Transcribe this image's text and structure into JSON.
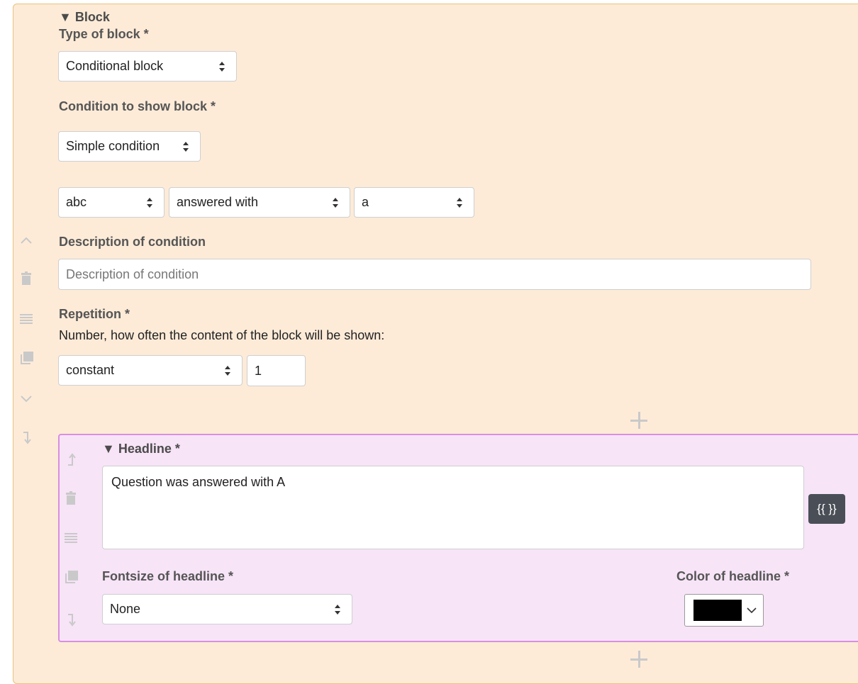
{
  "block": {
    "title": "▼ Block",
    "type_label": "Type of block *",
    "type_value": "Conditional block",
    "condition_label": "Condition to show block *",
    "condition_value": "Simple condition",
    "condition_row": {
      "question": "abc",
      "operator": "answered with",
      "answer": "a"
    },
    "description_label": "Description of condition",
    "description_placeholder": "Description of condition",
    "repetition_label": "Repetition *",
    "repetition_help": "Number, how often the content of the block will be shown:",
    "repetition_mode": "constant",
    "repetition_count": "1"
  },
  "headline": {
    "title": "▼ Headline *",
    "text": "Question was answered with A",
    "variables_button": "{{ }}",
    "fontsize_label": "Fontsize of headline *",
    "fontsize_value": "None",
    "color_label": "Color of headline *",
    "color_value": "#000000"
  },
  "icons": {
    "block_side": [
      "chevron-up-icon",
      "trash-icon",
      "drag-handle-icon",
      "duplicate-icon",
      "chevron-down-icon",
      "move-into-icon"
    ],
    "headline_side": [
      "move-out-icon",
      "trash-icon",
      "drag-handle-icon",
      "duplicate-icon",
      "move-into-icon"
    ],
    "add": "plus-icon"
  },
  "colors": {
    "block_bg": "#fdebd8",
    "block_border": "#e9c27e",
    "headline_bg": "#f7e4f7",
    "headline_border": "#d98ee0",
    "icon_gray": "#c9c9c9",
    "button_dark": "#4a4f57"
  }
}
